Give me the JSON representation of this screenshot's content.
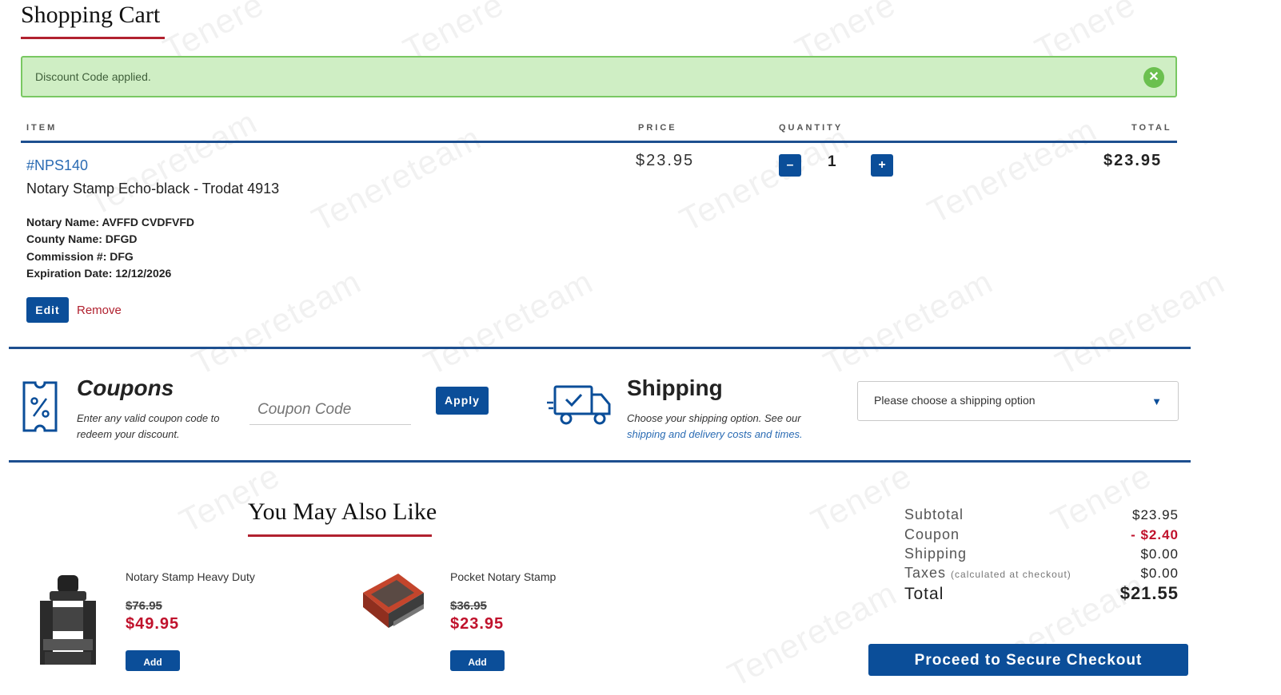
{
  "header": {
    "title": "Shopping Cart"
  },
  "alert": {
    "message": "Discount Code applied.",
    "close_icon": "close-circle-icon"
  },
  "table": {
    "headers": {
      "item": "ITEM",
      "price": "PRICE",
      "quantity": "QUANTITY",
      "total": "TOTAL"
    }
  },
  "cart_item": {
    "sku": "#NPS140",
    "name": "Notary Stamp Echo-black - Trodat 4913",
    "details": [
      "Notary Name: AVFFD CVDFVFD",
      "County Name: DFGD",
      "Commission #: DFG",
      "Expiration Date: 12/12/2026"
    ],
    "price": "$23.95",
    "quantity": "1",
    "decrement_label": "–",
    "increment_label": "+",
    "total": "$23.95",
    "edit_label": "Edit",
    "remove_label": "Remove"
  },
  "coupons": {
    "title": "Coupons",
    "subtitle": "Enter any valid coupon code to redeem your discount.",
    "placeholder": "Coupon Code",
    "apply_label": "Apply",
    "icon": "coupon-percent-icon"
  },
  "shipping": {
    "title": "Shipping",
    "subtitle": "Choose your shipping option. See our",
    "link_text": "shipping and delivery costs and times.",
    "select_value": "Please choose a shipping option",
    "icon": "delivery-truck-icon"
  },
  "recommendations": {
    "title": "You May Also Like",
    "items": [
      {
        "name": "Notary Stamp Heavy Duty",
        "old_price": "$76.95",
        "price": "$49.95",
        "add_label": "Add"
      },
      {
        "name": "Pocket Notary Stamp",
        "old_price": "$36.95",
        "price": "$23.95",
        "add_label": "Add"
      }
    ]
  },
  "summary": {
    "subtotal_label": "Subtotal",
    "subtotal": "$23.95",
    "coupon_label": "Coupon",
    "coupon": "- $2.40",
    "shipping_label": "Shipping",
    "shipping": "$0.00",
    "taxes_label": "Taxes",
    "taxes_note": "(calculated at checkout)",
    "taxes": "$0.00",
    "total_label": "Total",
    "total": "$21.55",
    "checkout_label": "Proceed to Secure Checkout"
  },
  "colors": {
    "brand_blue": "#0b4e99",
    "accent_red": "#b1212f",
    "success_bg": "#cfeec4",
    "success_border": "#79c862",
    "discount_red": "#c0122c"
  }
}
